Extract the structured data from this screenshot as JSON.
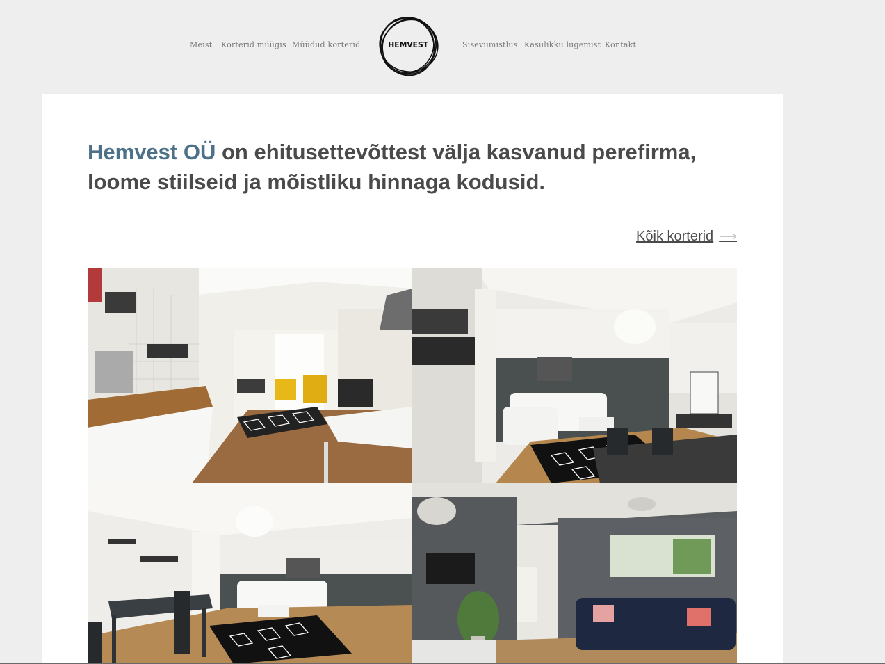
{
  "nav": {
    "left": [
      "Meist",
      "Korterid müügis",
      "Müüdud korterid"
    ],
    "right": [
      "Siseviimistlus",
      "Kasulikku lugemist",
      "Kontakt"
    ],
    "logo_text": "HEMVEST"
  },
  "intro": {
    "brand": "Hemvest OÜ",
    "text": " on ehitusettevõttest välja kasvanud perefirma, loome stiilseid ja mõistliku hinnaga kodusid."
  },
  "all_apartments": {
    "label": "Kõik korterid",
    "arrow": "⟶"
  },
  "colors": {
    "brand": "#4c7189",
    "text": "#4a4a4a",
    "nav": "#777777",
    "background": "#eeeeee"
  }
}
